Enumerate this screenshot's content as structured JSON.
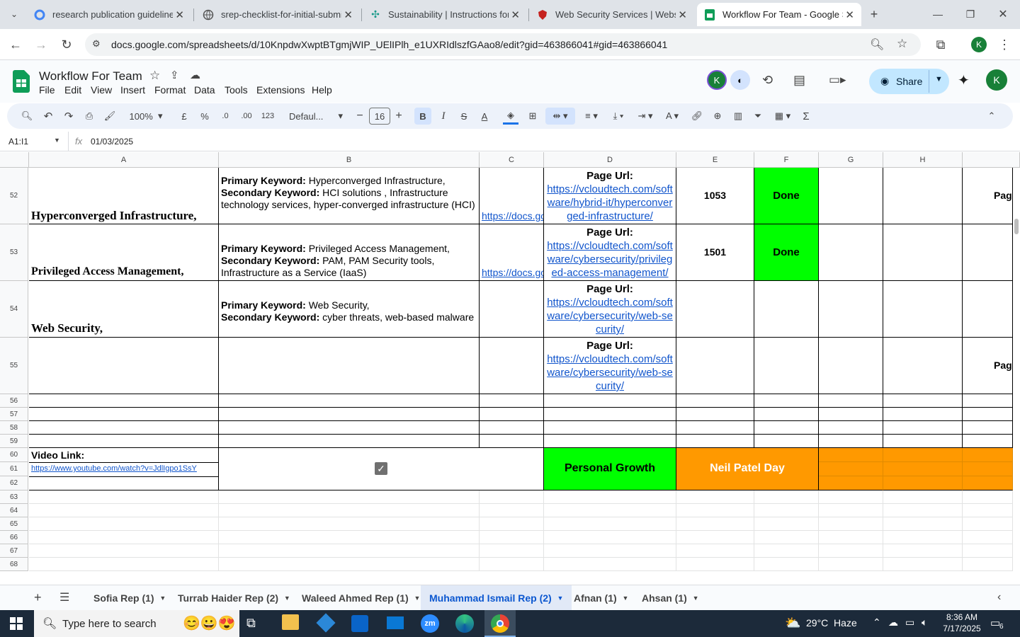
{
  "browser": {
    "tabs": [
      {
        "label": "research publication guidelines",
        "icon": "google-icon"
      },
      {
        "label": "srep-checklist-for-initial-submi",
        "icon": "globe-icon"
      },
      {
        "label": "Sustainability | Instructions for",
        "icon": "mdpi-icon"
      },
      {
        "label": "Web Security Services | Website",
        "icon": "shield-icon"
      },
      {
        "label": "Workflow For Team - Google Sh",
        "icon": "sheets-icon"
      }
    ],
    "url": "docs.google.com/spreadsheets/d/10KnpdwXwptBTgmjWIP_UElIPlh_e1UXRIdlszfGAao8/edit?gid=463866041#gid=463866041",
    "profile_initial": "K"
  },
  "sheet": {
    "title": "Workflow For Team",
    "menus": [
      "File",
      "Edit",
      "View",
      "Insert",
      "Format",
      "Data",
      "Tools",
      "Extensions",
      "Help"
    ],
    "share_label": "Share",
    "zoom": "100%",
    "currency": "£",
    "percent": "%",
    "dec_less": ".0",
    "dec_more": ".00",
    "number_format": "123",
    "font": "Defaul...",
    "font_size": "16",
    "cell_ref": "A1:I1",
    "formula_value": "01/03/2025",
    "user_initial": "K"
  },
  "columns": [
    "A",
    "B",
    "C",
    "D",
    "E",
    "F",
    "G",
    "H"
  ],
  "rows": {
    "r52": {
      "num": "52",
      "a": "Hyperconverged Infrastructure,",
      "b_pk_label": "Primary Keyword:",
      "b_pk": " Hyperconverged Infrastructure,",
      "b_sk_label": "Secondary Keyword:",
      "b_sk": " HCI solutions , Infrastructure technology services, hyper-converged infrastructure (HCI)",
      "c": "https://docs.goo",
      "d_label": "Page Url:",
      "d_link": "https://vcloudtech.com/software/hybrid-it/hyperconverged-infrastructure/",
      "e": "1053",
      "f": "Done",
      "i": "Page"
    },
    "r53": {
      "num": "53",
      "a": "Privileged Access Management,",
      "b_pk_label": "Primary Keyword:",
      "b_pk": " Privileged Access Management,",
      "b_sk_label": "Secondary Keyword:",
      "b_sk": " PAM, PAM Security tools, Infrastructure as a Service (IaaS)",
      "c": "https://docs.goo",
      "d_label": "Page Url:",
      "d_link": "https://vcloudtech.com/software/cybersecurity/privileged-access-management/",
      "e": "1501",
      "f": "Done"
    },
    "r54": {
      "num": "54",
      "a": "Web Security,",
      "b_pk_label": "Primary Keyword:",
      "b_pk": " Web Security,",
      "b_sk_label": "Secondary Keyword:",
      "b_sk": " cyber threats, web-based malware",
      "d_label": "Page Url:",
      "d_link": "https://vcloudtech.com/software/cybersecurity/web-security/"
    },
    "r55": {
      "num": "55",
      "d_label": "Page Url:",
      "d_link": "https://vcloudtech.com/software/cybersecurity/web-security/",
      "i": "Page"
    },
    "small": [
      "56",
      "57",
      "58",
      "59",
      "60",
      "61",
      "62",
      "63",
      "64",
      "65",
      "66",
      "67",
      "68"
    ],
    "video_label": "Video Link:",
    "video_link": "https://www.youtube.com/watch?v=JdlIgpo1SsY",
    "personal_growth": "Personal Growth",
    "neil_patel": "Neil Patel Day"
  },
  "sheet_tabs": [
    "Sofia Rep (1)",
    "Turrab Haider Rep (2)",
    "Waleed Ahmed Rep (1)",
    "Muhammad Ismail Rep (2)",
    "Afnan (1)",
    "Ahsan (1)"
  ],
  "active_sheet": "Muhammad Ismail Rep (2)",
  "taskbar": {
    "search_placeholder": "Type here to search",
    "weather": "29°C  Haze",
    "time": "8:36 AM",
    "date": "7/17/2025",
    "notifications": "6"
  },
  "colors": {
    "green": "#00ff00",
    "orange": "#ff9900",
    "accent": "#0b57d0"
  }
}
